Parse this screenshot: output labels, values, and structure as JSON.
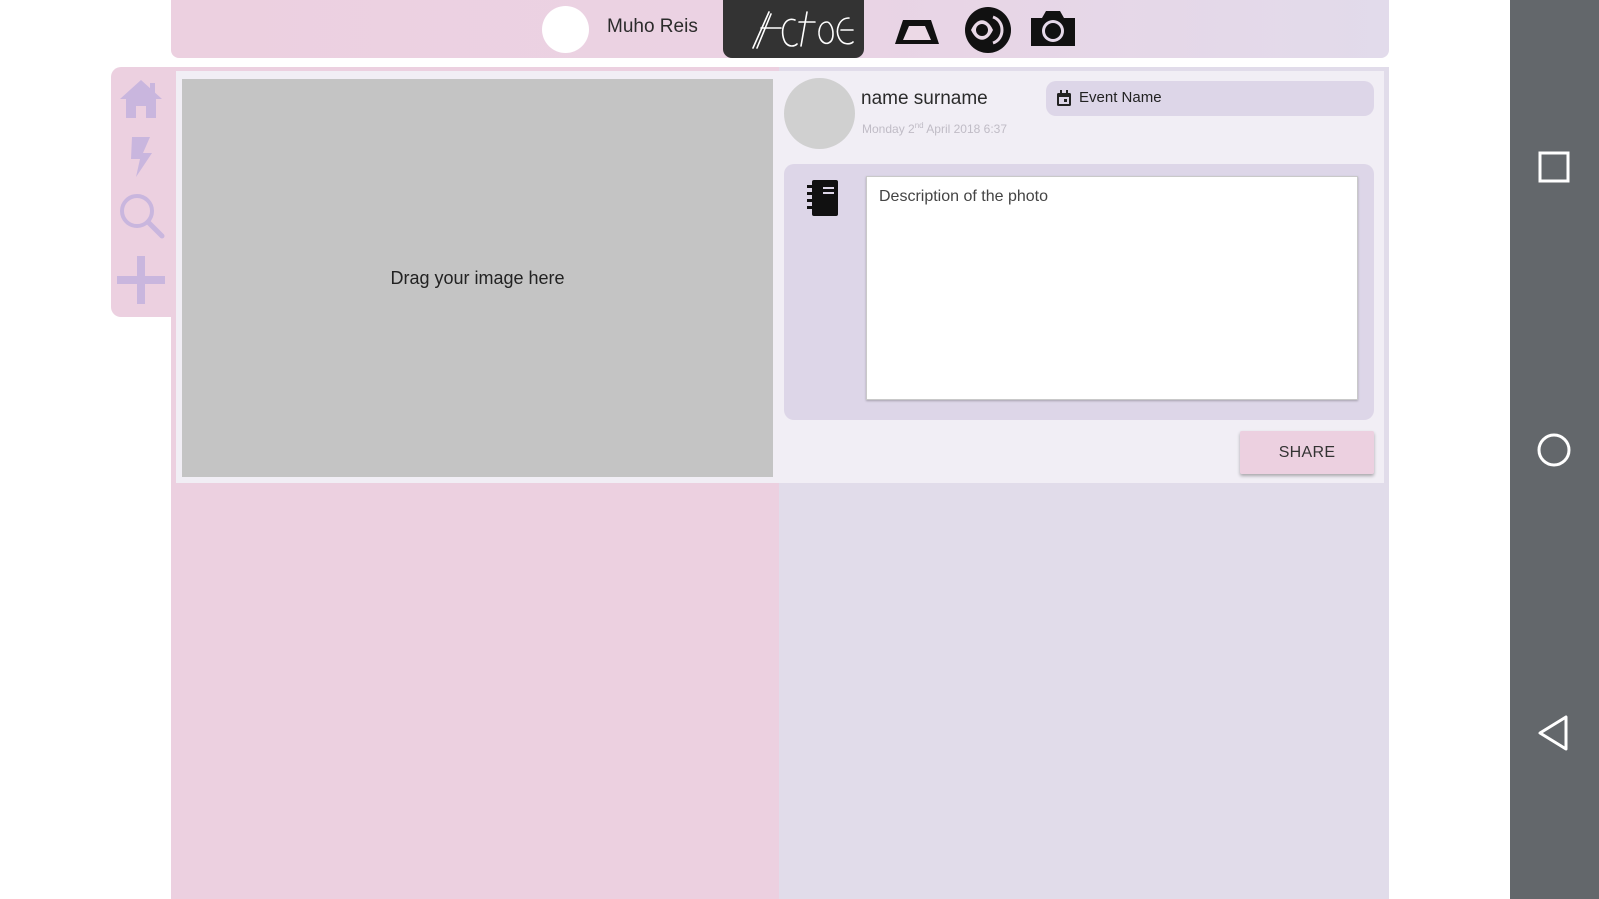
{
  "header": {
    "user_name": "Muho Reis",
    "logo_text": "Actoe",
    "icons": [
      "arch-icon",
      "eye-icon",
      "camera-icon"
    ]
  },
  "sidebar": {
    "items": [
      {
        "icon": "home-icon"
      },
      {
        "icon": "lightning-icon"
      },
      {
        "icon": "search-icon"
      },
      {
        "icon": "plus-icon"
      }
    ]
  },
  "composer": {
    "dropzone_text": "Drag your image here",
    "author_name": "name surname",
    "date": {
      "day": "Monday 2",
      "suffix": "nd",
      "rest": " April 2018 6:37"
    },
    "event_label": "Event Name",
    "description_placeholder": "Description of the photo",
    "share_label": "SHARE"
  },
  "system_nav": {
    "buttons": [
      "recents-square-icon",
      "home-circle-icon",
      "back-triangle-icon"
    ]
  },
  "colors": {
    "pink": "#ecd0e0",
    "lavender": "#e1dcea",
    "card": "#f1eef5",
    "panel": "#ddd6e8",
    "sysnav": "#63676b",
    "nav_icon": "#c9b6de"
  }
}
